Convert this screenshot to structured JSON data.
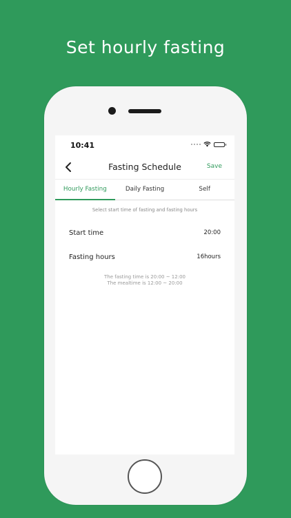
{
  "headline": "Set hourly fasting",
  "status_bar": {
    "time": "10:41"
  },
  "nav": {
    "title": "Fasting Schedule",
    "save_label": "Save"
  },
  "tabs": [
    {
      "label": "Hourly Fasting",
      "active": true
    },
    {
      "label": "Daily Fasting",
      "active": false
    },
    {
      "label": "Self",
      "active": false
    }
  ],
  "hint": "Select start time of fasting and fasting hours",
  "settings": {
    "start_time": {
      "label": "Start time",
      "value": "20:00"
    },
    "fasting_hours": {
      "label": "Fasting hours",
      "value": "16hours"
    }
  },
  "summary": {
    "fasting_line": "The fasting time is 20:00 ~ 12:00",
    "meal_line": "The mealtime is 12:00 ~ 20:00"
  },
  "colors": {
    "accent": "#2f9a5b",
    "background": "#2f9a5b"
  }
}
